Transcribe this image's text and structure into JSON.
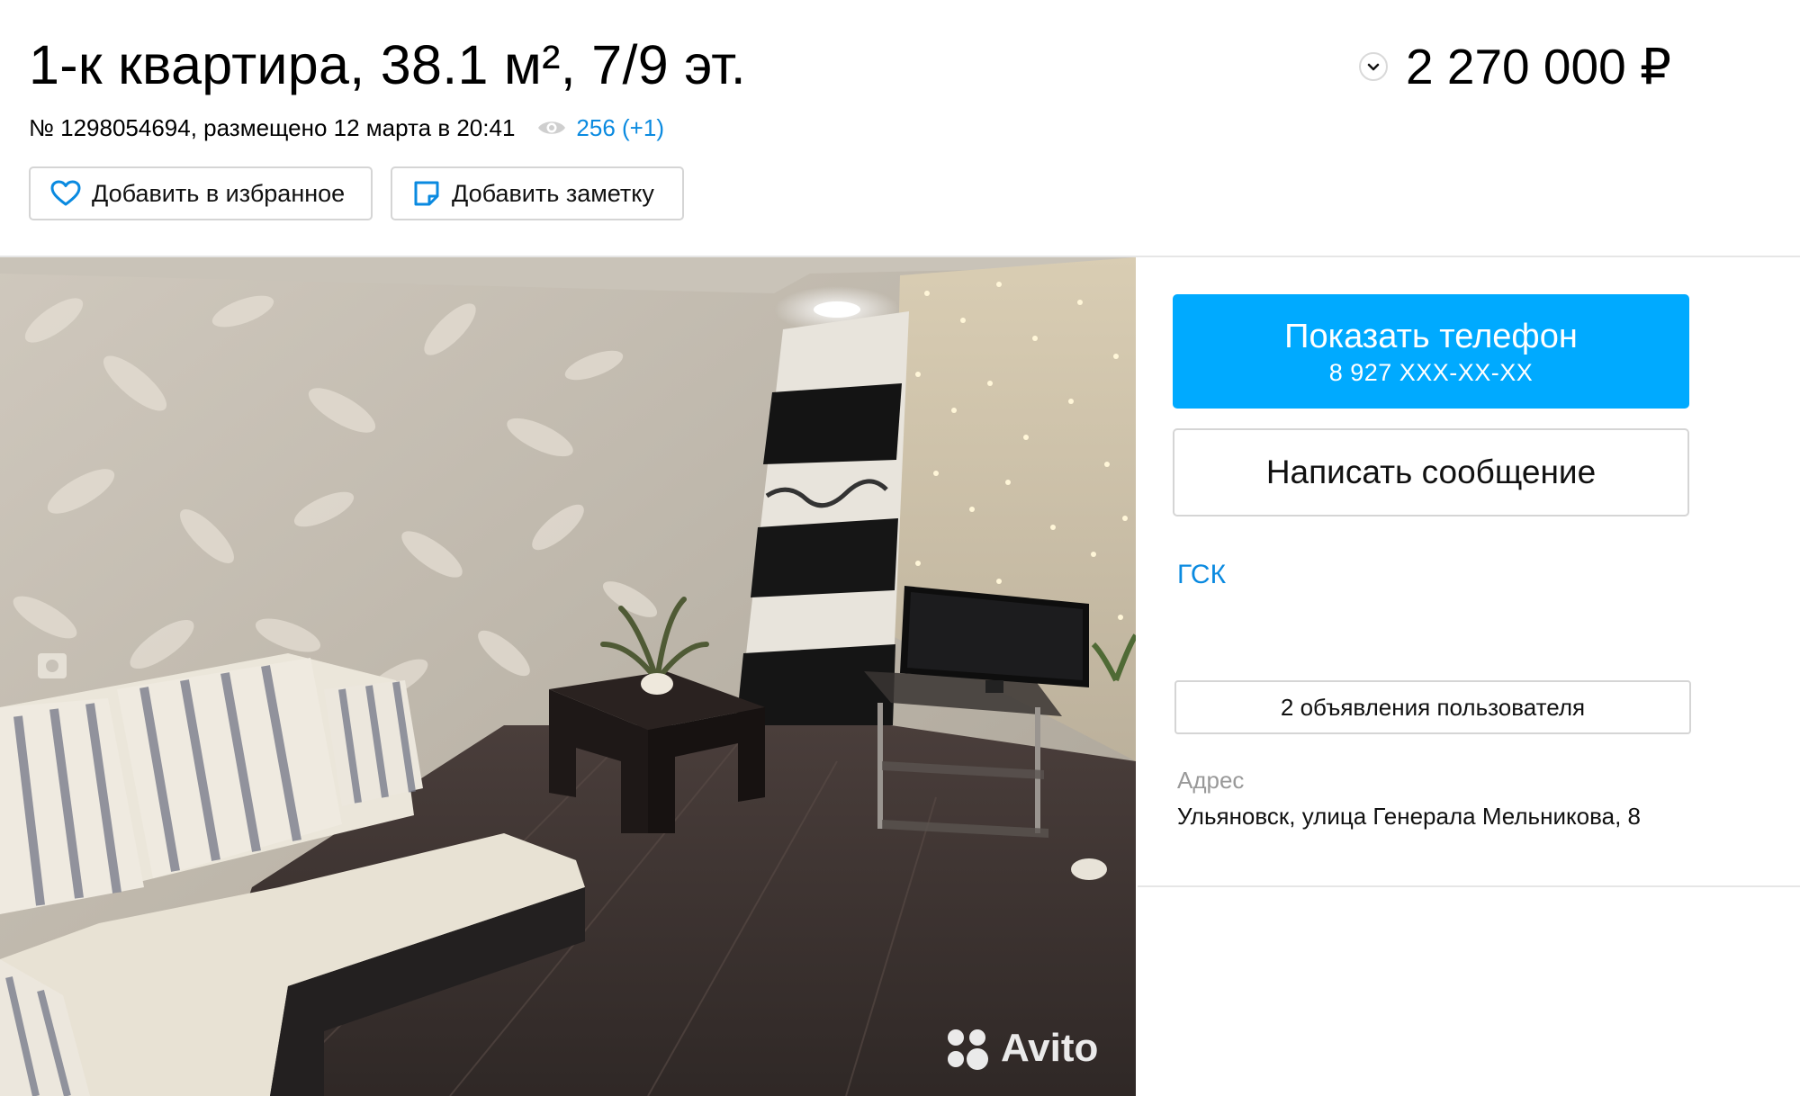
{
  "listing": {
    "title": "1-к квартира, 38.1 м², 7/9 эт.",
    "price": "2 270 000 ₽",
    "meta": "№ 1298054694, размещено 12 марта в 20:41",
    "views": "256 (+1)"
  },
  "actions": {
    "favorite_label": "Добавить в избранное",
    "note_label": "Добавить заметку"
  },
  "contact": {
    "show_phone_label": "Показать телефон",
    "phone_masked": "8 927 XXX-XX-XX",
    "message_label": "Написать сообщение",
    "seller_name": "ГСК",
    "seller_ads_label": "2 объявления пользователя",
    "address_label": "Адрес",
    "address_value": "Ульяновск, улица Генерала Мельникова, 8"
  },
  "photo": {
    "watermark": "Avito"
  },
  "icons": {
    "price_toggle": "chevron-down-icon",
    "views": "eye-icon",
    "favorite": "heart-icon",
    "note": "note-icon"
  },
  "colors": {
    "accent": "#00aaff",
    "link": "#0a8ae0",
    "muted": "#999999",
    "border": "#d5d5d5"
  }
}
